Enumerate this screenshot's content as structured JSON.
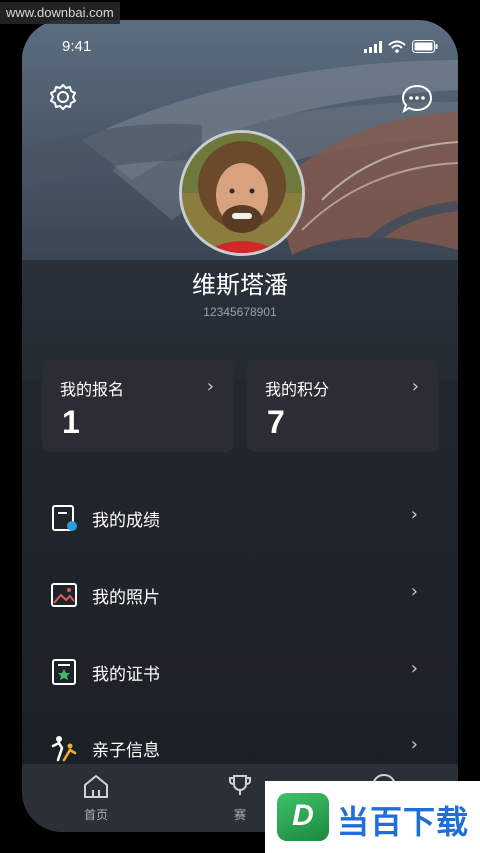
{
  "watermark": "www.downbai.com",
  "status_bar": {
    "time": "9:41"
  },
  "profile": {
    "name": "维斯塔潘",
    "id": "12345678901"
  },
  "stats": [
    {
      "label": "我的报名",
      "value": "1"
    },
    {
      "label": "我的积分",
      "value": "7"
    }
  ],
  "menu": [
    {
      "label": "我的成绩",
      "icon": "score-sheet-icon"
    },
    {
      "label": "我的照片",
      "icon": "photo-icon"
    },
    {
      "label": "我的证书",
      "icon": "certificate-icon"
    },
    {
      "label": "亲子信息",
      "icon": "family-icon"
    }
  ],
  "tabbar": [
    {
      "label": "首页",
      "icon": "home-icon"
    },
    {
      "label": "赛",
      "icon": "trophy-icon"
    },
    {
      "label": "",
      "icon": "profile-icon"
    }
  ],
  "brand_watermark": {
    "logo_letter": "D",
    "text": "当百下载"
  },
  "colors": {
    "accent_blue": "#1f6fd6",
    "brand_green": "#2fae55"
  }
}
